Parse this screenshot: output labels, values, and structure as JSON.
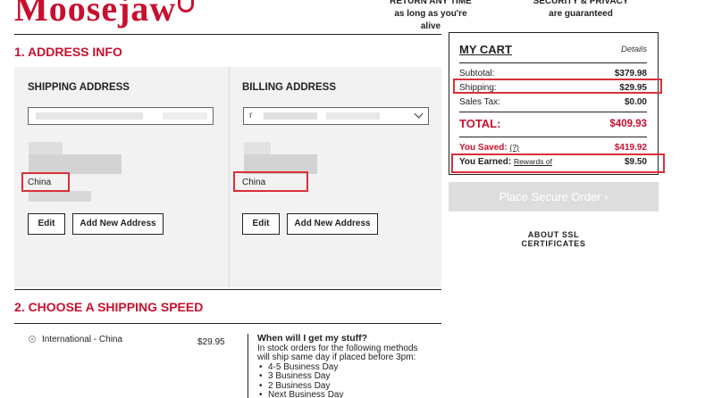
{
  "header": {
    "brand": "Moosejaw",
    "promo_1": [
      "RETURN ANY TIME",
      "as long as you're alive"
    ],
    "promo_2": [
      "SECURITY & PRIVACY",
      "are guaranteed"
    ]
  },
  "address_section": {
    "title": "1. ADDRESS INFO",
    "shipping": {
      "heading": "SHIPPING ADDRESS",
      "country": "China",
      "edit_label": "Edit",
      "add_label": "Add New Address"
    },
    "billing": {
      "heading": "BILLING ADDRESS",
      "select_value": "r",
      "country": "China",
      "edit_label": "Edit",
      "add_label": "Add New Address"
    }
  },
  "shipping_speed": {
    "title": "2. CHOOSE A SHIPPING SPEED",
    "option_label": "International - China",
    "option_price": "$29.95",
    "info_heading": "When will I get my stuff?",
    "info_text": [
      "In stock orders for the following methods",
      "will ship same day if placed before 3pm:"
    ],
    "methods": [
      "4-5 Business Day",
      "3 Business Day",
      "2 Business Day",
      "Next Business Day"
    ]
  },
  "cart": {
    "title": "MY CART",
    "details_label": "Details",
    "subtotal_label": "Subtotal:",
    "subtotal": "$379.98",
    "shipping_label": "Shipping:",
    "shipping": "$29.95",
    "tax_label": "Sales Tax:",
    "tax": "$0.00",
    "total_label": "TOTAL:",
    "total": "$409.93",
    "saved_label": "You Saved:",
    "saved_q": "(?)",
    "saved": "$419.92",
    "earned_label": "You Earned:",
    "earned_link": "Rewards of",
    "earned": "$9.50",
    "place_order_label": "Place Secure Order  ›"
  },
  "ssl": {
    "line_1": "ABOUT SSL",
    "line_2": "CERTIFICATES"
  },
  "colors": {
    "brand_red": "#c8102e",
    "highlight_red": "#d9303a",
    "panel_gray": "#f2f2f2"
  }
}
